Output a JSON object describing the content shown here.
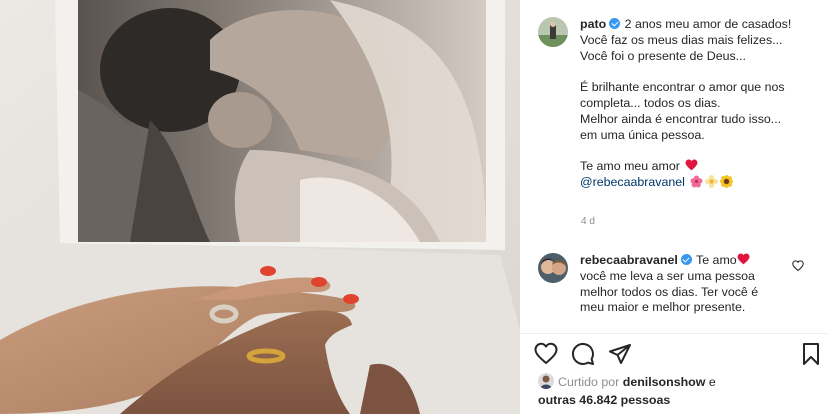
{
  "post": {
    "author": "pato",
    "caption_lines": [
      "2 anos meu amor de casados!",
      "Você faz os meus dias mais felizes...",
      "Você foi o presente de Deus...",
      "",
      "É brilhante encontrar o amor que nos",
      "completa... todos os dias.",
      "Melhor ainda é encontrar tudo isso...",
      "em uma única pessoa.",
      "",
      "Te amo meu amor"
    ],
    "mention": "@rebecaabravanel",
    "time_ago": "4 d"
  },
  "comment": {
    "author": "rebecaabravanel",
    "first_text": "Te amo",
    "lines": [
      "você me leva a ser uma pessoa",
      "melhor todos os dias. Ter você é",
      "meu maior e melhor presente."
    ]
  },
  "likes": {
    "prefix": "Curtido por",
    "user": "denilsonshow",
    "conjunction": "e",
    "others": "outras 46.842 pessoas"
  },
  "icons": {
    "verified": "verified-badge-icon",
    "like": "heart-outline-icon",
    "comment": "comment-bubble-icon",
    "share": "paper-plane-icon",
    "save": "bookmark-icon",
    "red_heart": "red-heart-emoji",
    "flowers": [
      "hibiscus-emoji",
      "blossom-emoji",
      "sunflower-emoji"
    ]
  },
  "colors": {
    "verified": "#3897f0",
    "text": "#262626",
    "muted": "#8e8e8e",
    "link": "#00376b",
    "heart": "#e0153d",
    "nail": "#e0432e"
  }
}
